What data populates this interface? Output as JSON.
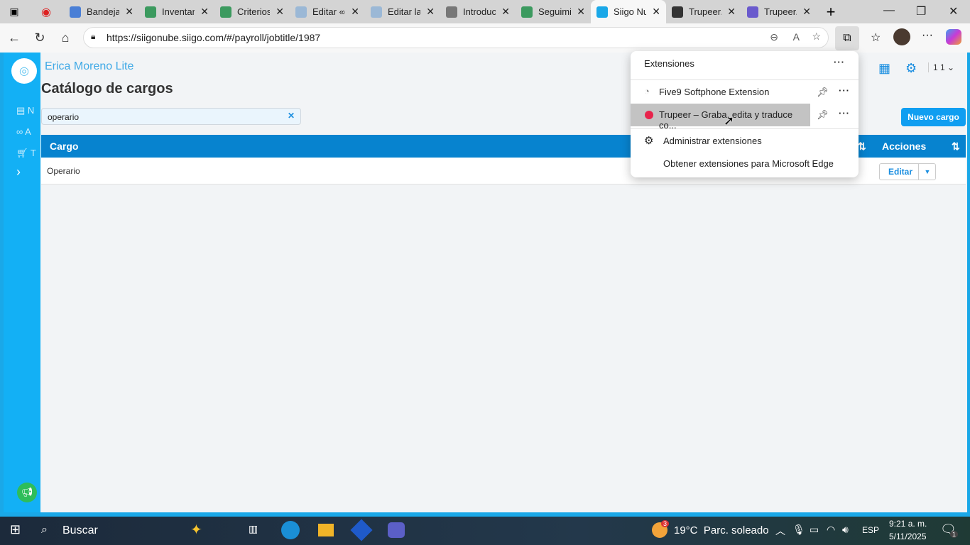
{
  "browser": {
    "tabs": [
      {
        "label": "Bandeja",
        "color": "#4a7fd6"
      },
      {
        "label": "Inventar",
        "color": "#3c9a5f"
      },
      {
        "label": "Criterios",
        "color": "#3c9a5f"
      },
      {
        "label": "Editar «(",
        "color": "#9bb8d6"
      },
      {
        "label": "Editar la",
        "color": "#9bb8d6"
      },
      {
        "label": "Introduc",
        "color": "#777777"
      },
      {
        "label": "Seguimi",
        "color": "#3c9a5f"
      },
      {
        "label": "Siigo Nu",
        "color": "#1aa8e8"
      },
      {
        "label": "Trupeer.",
        "color": "#333333"
      },
      {
        "label": "Trupeer.",
        "color": "#6a5acd"
      }
    ],
    "url": "https://siigonube.siigo.com/#/payroll/jobtitle/1987"
  },
  "app": {
    "company": "Erica Moreno Lite",
    "title": "Catálogo de cargos",
    "search_value": "operario",
    "new_button": "Nuevo cargo",
    "sidebar_items": [
      "N",
      "A",
      "T"
    ],
    "user_label": "1 1",
    "table": {
      "headers": [
        "Cargo",
        "Acciones"
      ],
      "rows": [
        {
          "cargo": "Operario",
          "action": "Editar"
        }
      ]
    }
  },
  "extensions_popup": {
    "title": "Extensiones",
    "items": [
      "Five9 Softphone Extension",
      "Trupeer – Graba, edita y traduce co..."
    ],
    "manage": "Administrar extensiones",
    "get": "Obtener extensiones para Microsoft Edge"
  },
  "taskbar": {
    "search": "Buscar",
    "weather": "19°C  Parc. soleado",
    "weather_badge": "3",
    "lang": "ESP",
    "time": "9:21 a. m.",
    "date": "5/11/2025",
    "notif_count": "1"
  }
}
